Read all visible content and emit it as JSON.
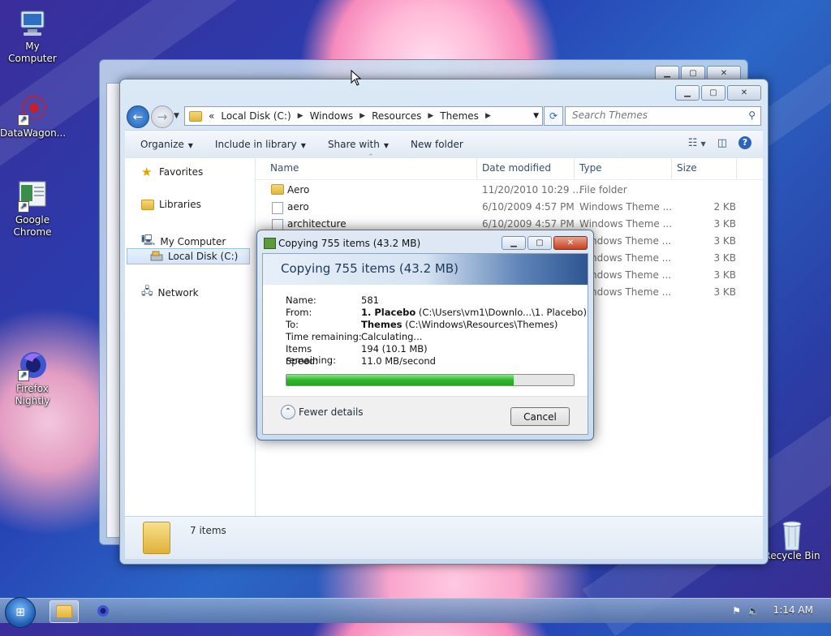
{
  "desktop": {
    "icons": [
      {
        "name": "my-computer",
        "label": "My Computer",
        "icon": "computer-icon"
      },
      {
        "name": "datawagon",
        "label": "DataWagon...",
        "icon": "datawagon-icon"
      },
      {
        "name": "google-chrome",
        "label": "Google Chrome",
        "icon": "chrome-icon"
      },
      {
        "name": "firefox-nightly",
        "label": "Firefox Nightly",
        "icon": "firefox-nightly-icon"
      },
      {
        "name": "recycle-bin",
        "label": "Recycle Bin",
        "icon": "recycle-bin-icon"
      }
    ]
  },
  "explorer": {
    "address": {
      "prefix": "«",
      "segments": [
        "Local Disk (C:)",
        "Windows",
        "Resources",
        "Themes"
      ]
    },
    "search_placeholder": "Search Themes",
    "toolbar": {
      "organize": "Organize",
      "include_in_library": "Include in library",
      "share_with": "Share with",
      "new_folder": "New folder"
    },
    "nav": {
      "favorites": "Favorites",
      "libraries": "Libraries",
      "my_computer": "My Computer",
      "local_disk": "Local Disk (C:)",
      "network": "Network"
    },
    "columns": {
      "name": "Name",
      "date_modified": "Date modified",
      "type": "Type",
      "size": "Size"
    },
    "files": [
      {
        "name": "Aero",
        "date": "11/20/2010 10:29 ...",
        "type": "File folder",
        "size": ""
      },
      {
        "name": "aero",
        "date": "6/10/2009 4:57 PM",
        "type": "Windows Theme ...",
        "size": "2 KB"
      },
      {
        "name": "architecture",
        "date": "6/10/2009 4:57 PM",
        "type": "Windows Theme ...",
        "size": "3 KB"
      },
      {
        "name": "",
        "date": "",
        "type": "ndows Theme ...",
        "size": "3 KB"
      },
      {
        "name": "",
        "date": "",
        "type": "ndows Theme ...",
        "size": "3 KB"
      },
      {
        "name": "",
        "date": "",
        "type": "ndows Theme ...",
        "size": "3 KB"
      },
      {
        "name": "",
        "date": "",
        "type": "ndows Theme ...",
        "size": "3 KB"
      }
    ],
    "status": "7 items"
  },
  "copy_dialog": {
    "title": "Copying 755 items (43.2 MB)",
    "heading": "Copying 755 items (43.2 MB)",
    "name_label": "Name:",
    "name_value": "581",
    "from_label": "From:",
    "from_bold": "1. Placebo",
    "from_path": "(C:\\Users\\vm1\\Downlo...\\1. Placebo)",
    "to_label": "To:",
    "to_bold": "Themes",
    "to_path": "(C:\\Windows\\Resources\\Themes)",
    "time_label": "Time remaining:",
    "time_value": "Calculating...",
    "items_label": "Items remaining:",
    "items_value": "194 (10.1 MB)",
    "speed_label": "Speed:",
    "speed_value": "11.0 MB/second",
    "progress": 0.79,
    "fewer_details": "Fewer details",
    "cancel": "Cancel"
  },
  "taskbar": {
    "clock": "1:14 AM"
  }
}
